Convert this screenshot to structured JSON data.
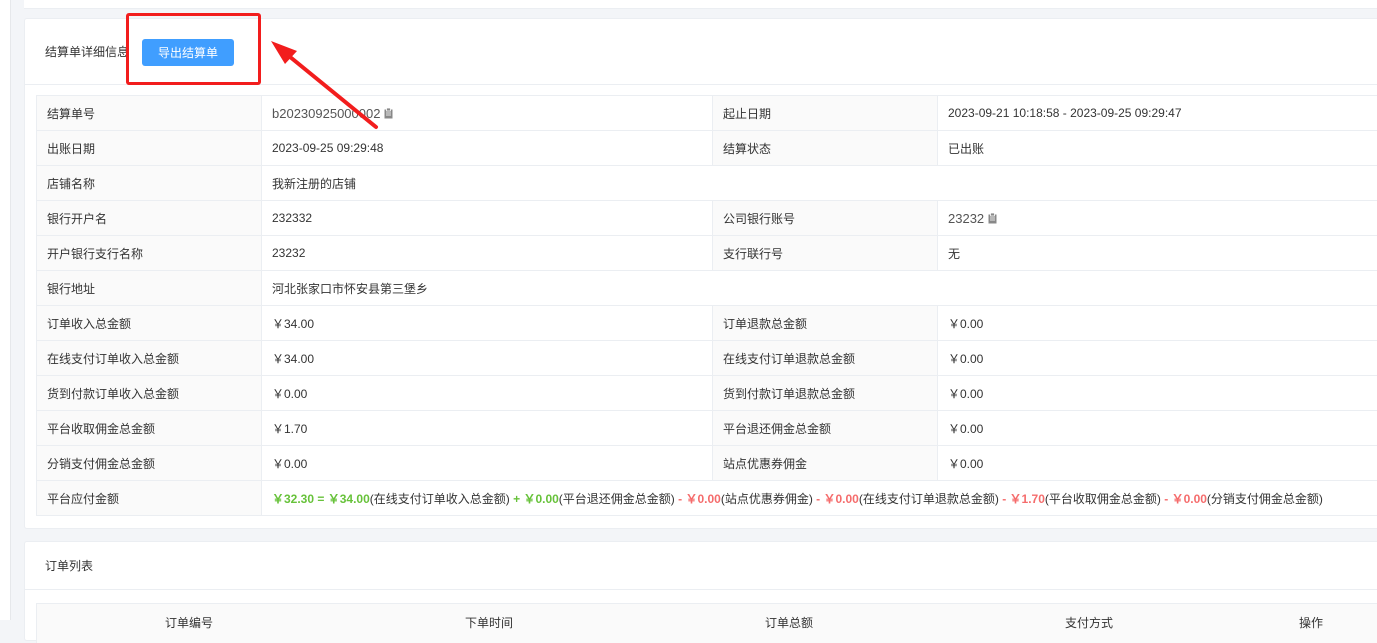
{
  "detail": {
    "title": "结算单详细信息",
    "export_label": "导出结算单",
    "rows": [
      {
        "l1": "结算单号",
        "v1": "b20230925000002",
        "l2": "起止日期",
        "v2": "2023-09-21 10:18:58 - 2023-09-25 09:29:47"
      },
      {
        "l1": "出账日期",
        "v1": "2023-09-25 09:29:48",
        "l2": "结算状态",
        "v2": "已出账"
      },
      {
        "l1": "店铺名称",
        "v1": "我新注册的店铺"
      },
      {
        "l1": "银行开户名",
        "v1": "232332",
        "l2": "公司银行账号",
        "v2": "23232"
      },
      {
        "l1": "开户银行支行名称",
        "v1": "23232",
        "l2": "支行联行号",
        "v2": "无"
      },
      {
        "l1": "银行地址",
        "v1": "河北张家口市怀安县第三堡乡"
      },
      {
        "l1": "订单收入总金额",
        "v1": "￥34.00",
        "l2": "订单退款总金额",
        "v2": "￥0.00"
      },
      {
        "l1": "在线支付订单收入总金额",
        "v1": "￥34.00",
        "l2": "在线支付订单退款总金额",
        "v2": "￥0.00"
      },
      {
        "l1": "货到付款订单收入总金额",
        "v1": "￥0.00",
        "l2": "货到付款订单退款总金额",
        "v2": "￥0.00"
      },
      {
        "l1": "平台收取佣金总金额",
        "v1": "￥1.70",
        "l2": "平台退还佣金总金额",
        "v2": "￥0.00"
      },
      {
        "l1": "分销支付佣金总金额",
        "v1": "￥0.00",
        "l2": "站点优惠券佣金",
        "v2": "￥0.00"
      }
    ],
    "payable": {
      "label": "平台应付金额",
      "total": "￥32.30 = ",
      "a1": "￥34.00",
      "t1": "(在线支付订单收入总金额)",
      "op2": " + ",
      "a2": "￥0.00",
      "t2": "(平台退还佣金总金额)",
      "op3": " - ",
      "a3": "￥0.00",
      "t3": "(站点优惠券佣金)",
      "op4": " - ",
      "a4": "￥0.00",
      "t4": "(在线支付订单退款总金额)",
      "op5": " - ",
      "a5": "￥1.70",
      "t5": "(平台收取佣金总金额)",
      "op6": " - ",
      "a6": "￥0.00",
      "t6": "(分销支付佣金总金额)"
    }
  },
  "orders": {
    "title": "订单列表",
    "columns": [
      "订单编号",
      "下单时间",
      "订单总额",
      "支付方式",
      "操作"
    ]
  },
  "colors": {
    "primary": "#409eff",
    "green": "#67c23a",
    "red": "#f56c6c",
    "annotation": "#f21d1d"
  }
}
